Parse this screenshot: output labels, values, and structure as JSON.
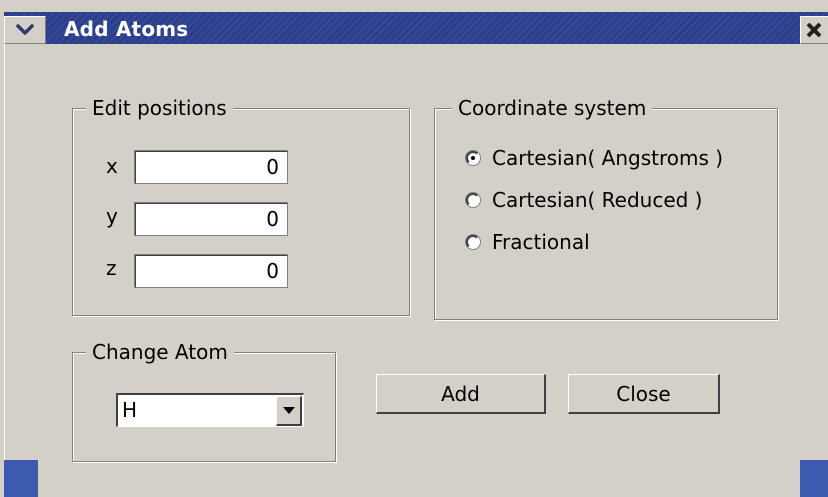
{
  "window": {
    "title": "Add Atoms"
  },
  "edit_positions": {
    "label": "Edit positions",
    "fields": [
      {
        "label": "x",
        "value": "0"
      },
      {
        "label": "y",
        "value": "0"
      },
      {
        "label": "z",
        "value": "0"
      }
    ]
  },
  "coordinate_system": {
    "label": "Coordinate system",
    "options": [
      {
        "label": "Cartesian( Angstroms )",
        "checked": true
      },
      {
        "label": "Cartesian( Reduced )",
        "checked": false
      },
      {
        "label": "Fractional",
        "checked": false
      }
    ]
  },
  "change_atom": {
    "label": "Change Atom",
    "selected": "H"
  },
  "buttons": {
    "add_label": "Add",
    "close_label": "Close"
  },
  "icons": {
    "window_menu": "chevron-down-icon",
    "window_close": "close-icon",
    "dropdown": "triangle-down-icon"
  },
  "colors": {
    "titlebar": "#2a3e8c",
    "window_bg": "#d4d0c8"
  }
}
